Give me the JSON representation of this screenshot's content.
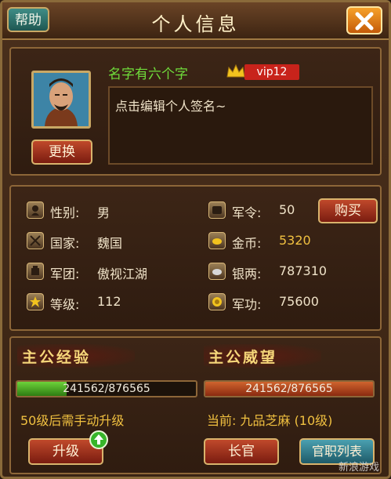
{
  "header": {
    "help_label": "帮助",
    "title": "个人信息"
  },
  "profile": {
    "name": "名字有六个字",
    "vip_label": "vip12",
    "signature_placeholder": "点击编辑个人签名~",
    "change_button": "更换"
  },
  "stats_left": [
    {
      "icon": "gender-icon",
      "label": "性别:",
      "value": "男"
    },
    {
      "icon": "country-icon",
      "label": "国家:",
      "value": "魏国"
    },
    {
      "icon": "legion-icon",
      "label": "军团:",
      "value": "傲视江湖"
    },
    {
      "icon": "level-icon",
      "label": "等级:",
      "value": "112"
    }
  ],
  "stats_right": [
    {
      "icon": "military-order-icon",
      "label": "军令:",
      "value": "50"
    },
    {
      "icon": "gold-icon",
      "label": "金币:",
      "value": "5320"
    },
    {
      "icon": "silver-icon",
      "label": "银两:",
      "value": "787310"
    },
    {
      "icon": "merit-icon",
      "label": "军功:",
      "value": "75600"
    }
  ],
  "buy_button": "购买",
  "experience": {
    "title": "主公经验",
    "text": "241562/876565",
    "progress": 0.276,
    "note": "50级后需手动升级",
    "upgrade_button": "升级"
  },
  "prestige": {
    "title": "主公威望",
    "text": "241562/876565",
    "progress": 1.0,
    "current": "当前: 九品芝麻 (10级)",
    "elder_button": "长官",
    "rank_list_button": "官职列表"
  },
  "watermark": "新浪游戏",
  "colors": {
    "gold_value": "#f0c040",
    "exp_bar": "#3f9a1c",
    "prestige_bar": "#b24a1e",
    "name": "#6fdc3b"
  }
}
